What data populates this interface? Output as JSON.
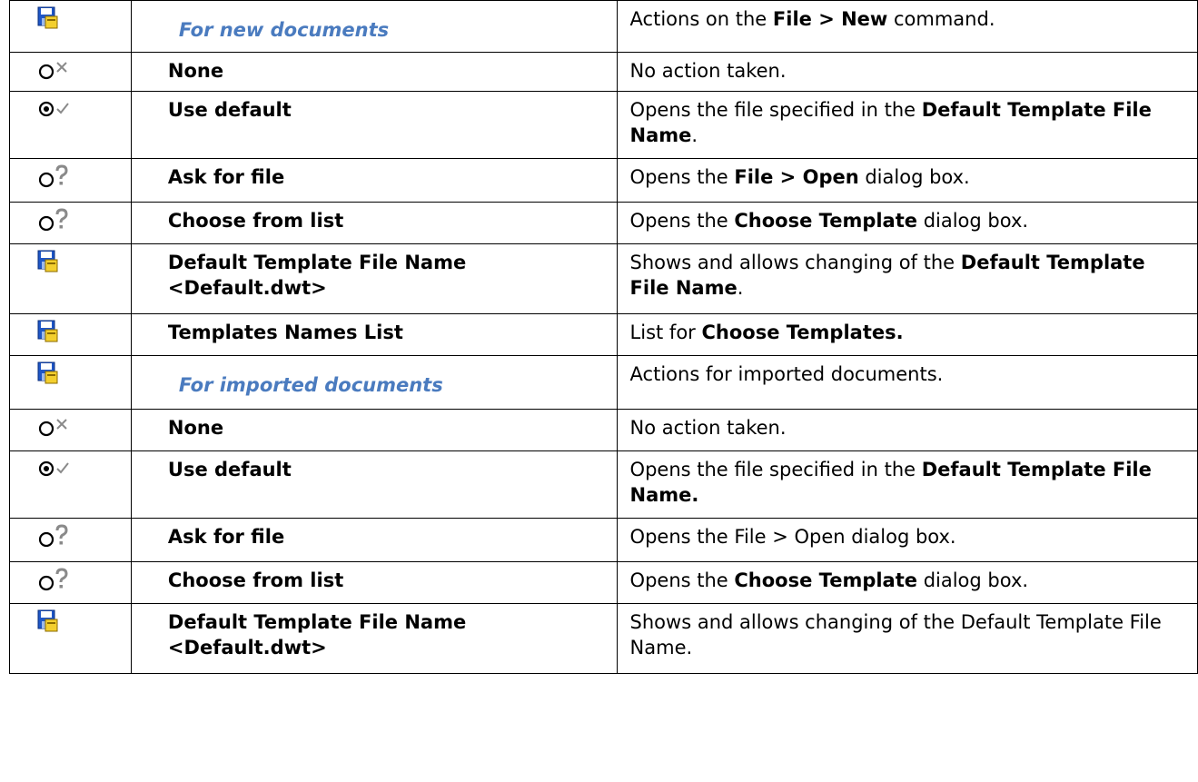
{
  "rows": [
    {
      "icon": "save-icon",
      "name": "For new documents",
      "section": true,
      "desc": [
        {
          "t": "Actions on the "
        },
        {
          "t": "File > New",
          "b": true
        },
        {
          "t": " command."
        }
      ]
    },
    {
      "icon": "radio-cross-icon",
      "name": "None",
      "desc": [
        {
          "t": "No action taken."
        }
      ]
    },
    {
      "icon": "radio-check-icon",
      "name": "Use default",
      "desc": [
        {
          "t": "Opens the file specified in the "
        },
        {
          "t": "Default Template File Name",
          "b": true
        },
        {
          "t": "."
        }
      ]
    },
    {
      "icon": "radio-question-icon",
      "name": "Ask for file",
      "desc": [
        {
          "t": "Opens the "
        },
        {
          "t": "File > Open",
          "b": true
        },
        {
          "t": " dialog box."
        }
      ]
    },
    {
      "icon": "radio-question-icon",
      "name": "Choose from list",
      "desc": [
        {
          "t": "Opens the "
        },
        {
          "t": "Choose Template",
          "b": true
        },
        {
          "t": " dialog box."
        }
      ]
    },
    {
      "icon": "save-icon",
      "name": "Default Template File Name <Default.dwt>",
      "desc": [
        {
          "t": "Shows and allows changing of the "
        },
        {
          "t": "Default Template File Name",
          "b": true
        },
        {
          "t": "."
        }
      ]
    },
    {
      "icon": "save-icon",
      "name": "Templates Names List",
      "desc": [
        {
          "t": "List for "
        },
        {
          "t": "Choose Templates.",
          "b": true
        }
      ]
    },
    {
      "icon": "save-icon",
      "name": "For imported documents",
      "section": true,
      "desc": [
        {
          "t": "Actions for imported documents."
        }
      ]
    },
    {
      "icon": "radio-cross-icon",
      "name": "None",
      "desc": [
        {
          "t": "No action taken."
        }
      ]
    },
    {
      "icon": "radio-check-icon",
      "name": "Use default",
      "desc": [
        {
          "t": "Opens the file specified in the "
        },
        {
          "t": "Default Template File Name.",
          "b": true
        }
      ]
    },
    {
      "icon": "radio-question-icon",
      "name": "Ask for file",
      "desc": [
        {
          "t": "Opens the File > Open dialog box."
        }
      ]
    },
    {
      "icon": "radio-question-icon",
      "name": "Choose from list",
      "desc": [
        {
          "t": "Opens the "
        },
        {
          "t": "Choose Template",
          "b": true
        },
        {
          "t": " dialog box."
        }
      ]
    },
    {
      "icon": "save-icon",
      "name": "Default Template File Name <Default.dwt>",
      "desc": [
        {
          "t": "Shows and allows changing of the Default Template File Name."
        }
      ]
    }
  ]
}
